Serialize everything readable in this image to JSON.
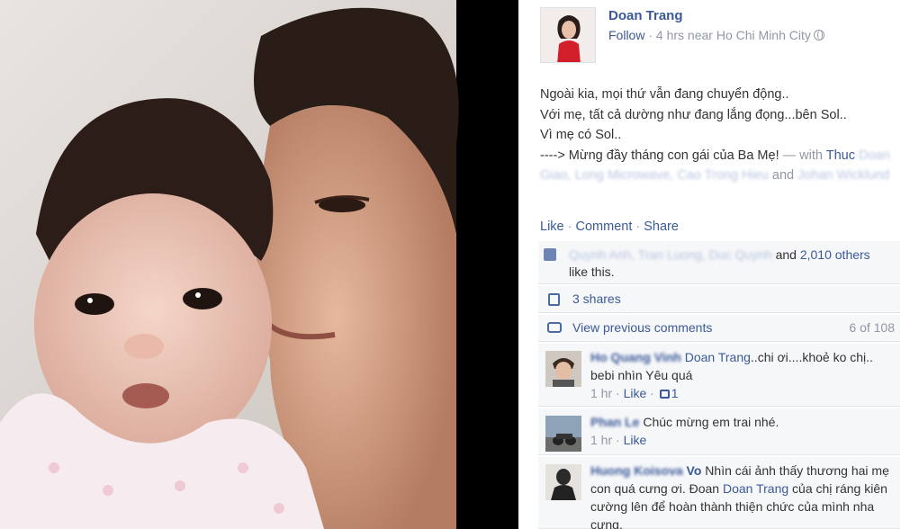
{
  "photo": {
    "alt": ""
  },
  "post": {
    "author": "Doan Trang",
    "follow": "Follow",
    "meta_sep": " · ",
    "time_location": "4 hrs near Ho Chi Minh City",
    "privacy_icon": "globe-icon",
    "lines": [
      "Ngoài kia, mọi thứ vẫn đang chuyển động..",
      "Với mẹ, tất cả dường như đang lắng đọng...bên Sol..",
      "Vì mẹ có Sol..",
      "----> Mừng đầy tháng con gái của Ba Mẹ!"
    ],
    "with_prefix": " — with ",
    "tagged_first": "Thuc",
    "tagged_blurred": "Doan Giao, Long Microwave, Cao Trong Hieu",
    "and_word": " and ",
    "tagged_last_blurred": "Johan Wicklund"
  },
  "actions": {
    "like": "Like",
    "comment": "Comment",
    "share": "Share",
    "sep": " · "
  },
  "likes": {
    "blurred_names": "Quynh Anh, Tran Luong, Duc Quynh",
    "and_word": " and ",
    "others": "2,010 others",
    "suffix": "like this."
  },
  "shares": {
    "text": "3 shares"
  },
  "prev_comments": {
    "text": "View previous comments",
    "count": "6 of 108"
  },
  "comments": [
    {
      "name_blurred": "Ho Quang Vinh",
      "mention": "Doan Trang",
      "text": "..chi ơi....khoẻ ko chị.. bebi nhìn Yêu quá",
      "time": "1 hr",
      "like": "Like",
      "like_count": "1"
    },
    {
      "name_blurred": "Phan Le",
      "text": "Chúc mừng em trai nhé.",
      "time": "1 hr",
      "like": "Like"
    },
    {
      "name_blurred": "Huong Koisova",
      "name_visible": " Vo",
      "text_before": " Nhìn cái ảnh thấy thương hai mẹ con quá cưng ơi. Đoan ",
      "mention": "Doan Trang",
      "text_after": " của chị ráng kiên cường lên để hoàn thành thiện chức của mình nha cưng."
    }
  ],
  "colors": {
    "link": "#3b5998",
    "muted": "#9197a3",
    "box_bg": "#f6f7f9"
  }
}
